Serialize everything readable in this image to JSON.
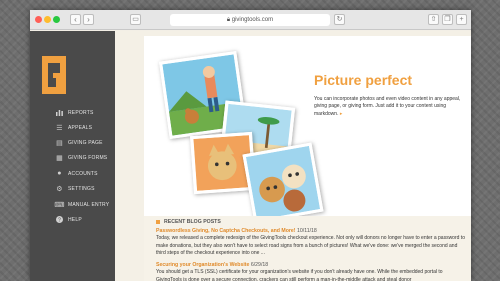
{
  "browser": {
    "url": "givingtools.com",
    "back_icon": "chevron-left-icon",
    "forward_icon": "chevron-right-icon"
  },
  "sidebar": {
    "logo_letter": "G",
    "items": [
      {
        "label": "REPORTS",
        "icon": "bar-chart-icon"
      },
      {
        "label": "APPEALS",
        "icon": "list-icon"
      },
      {
        "label": "GIVING PAGE",
        "icon": "document-icon"
      },
      {
        "label": "GIVING FORMS",
        "icon": "form-icon"
      },
      {
        "label": "ACCOUNTS",
        "icon": "user-icon"
      },
      {
        "label": "SETTINGS",
        "icon": "gear-icon"
      },
      {
        "label": "MANUAL ENTRY",
        "icon": "keyboard-icon"
      },
      {
        "label": "HELP",
        "icon": "question-icon"
      }
    ]
  },
  "feature": {
    "headline": "Picture perfect",
    "description": "You can incorporate photos and even video content in any appeal, giving page, or giving form. Just add it to your content using markdown.",
    "arrow": "▸"
  },
  "blog": {
    "heading": "RECENT BLOG POSTS",
    "posts": [
      {
        "title": "Passwordless Giving, No Captcha Checkouts, and More!",
        "date": "10/11/18",
        "body": "Today, we released a complete redesign of the GivingTools checkout experience. Not only will donors no longer have to enter a password to make donations, but they also won't have to select road signs from a bunch of pictures! What we've done: we've merged the second and third steps of the checkout experience into one ..."
      },
      {
        "title": "Securing your Organization's Website",
        "date": "6/29/18",
        "body": "You should get a TLS (SSL) certificate for your organization's website if you don't already have one. While the embedded portal to GivingTools is done over a secure connection, crackers can still perform a man-in-the-middle attack and steal donor"
      }
    ]
  },
  "colors": {
    "accent": "#f0a040",
    "sidebar": "#4a4a4a",
    "background": "#f4f0e6"
  }
}
